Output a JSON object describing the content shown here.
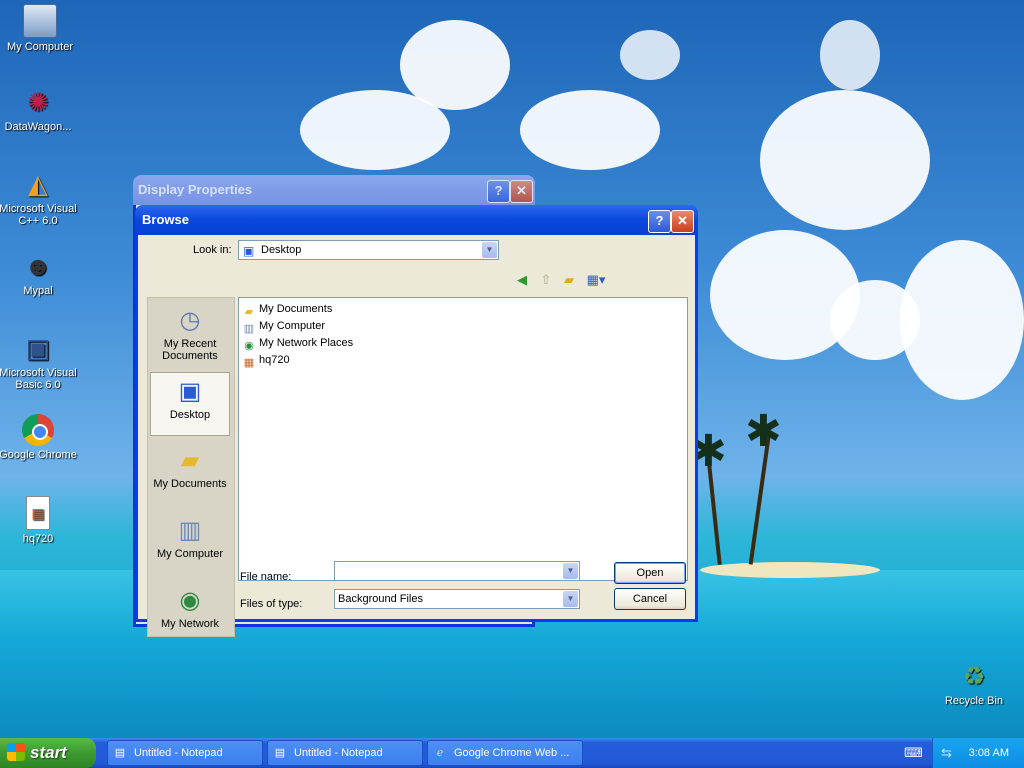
{
  "desktop": {
    "icons": [
      {
        "label": "My Computer",
        "icon": "my-computer-icon"
      },
      {
        "label": "DataWagon...",
        "icon": "datawagon-icon"
      },
      {
        "label": "Microsoft Visual C++ 6.0",
        "icon": "visual-cpp-icon"
      },
      {
        "label": "Mypal",
        "icon": "mypal-icon"
      },
      {
        "label": "Microsoft Visual Basic 6.0",
        "icon": "visual-basic-icon"
      },
      {
        "label": "Google Chrome",
        "icon": "chrome-icon"
      },
      {
        "label": "hq720",
        "icon": "image-file-icon"
      },
      {
        "label": "Recycle Bin",
        "icon": "recycle-bin-icon"
      }
    ]
  },
  "display_properties": {
    "title": "Display Properties",
    "help": "?",
    "close": "✕"
  },
  "browse": {
    "title": "Browse",
    "help": "?",
    "close": "✕",
    "look_in_label": "Look in:",
    "look_in_value": "Desktop",
    "places": [
      {
        "label": "My Recent Documents",
        "icon": "recent-documents-icon"
      },
      {
        "label": "Desktop",
        "icon": "desktop-icon"
      },
      {
        "label": "My Documents",
        "icon": "my-documents-icon"
      },
      {
        "label": "My Computer",
        "icon": "my-computer-icon"
      },
      {
        "label": "My Network",
        "icon": "my-network-icon"
      }
    ],
    "files": [
      {
        "name": "My Documents",
        "icon": "folder-icon"
      },
      {
        "name": "My Computer",
        "icon": "computer-icon"
      },
      {
        "name": "My Network Places",
        "icon": "network-icon"
      },
      {
        "name": "hq720",
        "icon": "image-file-icon"
      }
    ],
    "file_name_label": "File name:",
    "file_name_value": "",
    "files_of_type_label": "Files of type:",
    "files_of_type_value": "Background Files",
    "open_button": "Open",
    "cancel_button": "Cancel"
  },
  "taskbar": {
    "start": "start",
    "tasks": [
      {
        "label": "Untitled - Notepad",
        "icon": "notepad-icon"
      },
      {
        "label": "Untitled - Notepad",
        "icon": "notepad-icon"
      },
      {
        "label": "Google Chrome Web ...",
        "icon": "ie-icon"
      }
    ],
    "clock": "3:08 AM"
  }
}
